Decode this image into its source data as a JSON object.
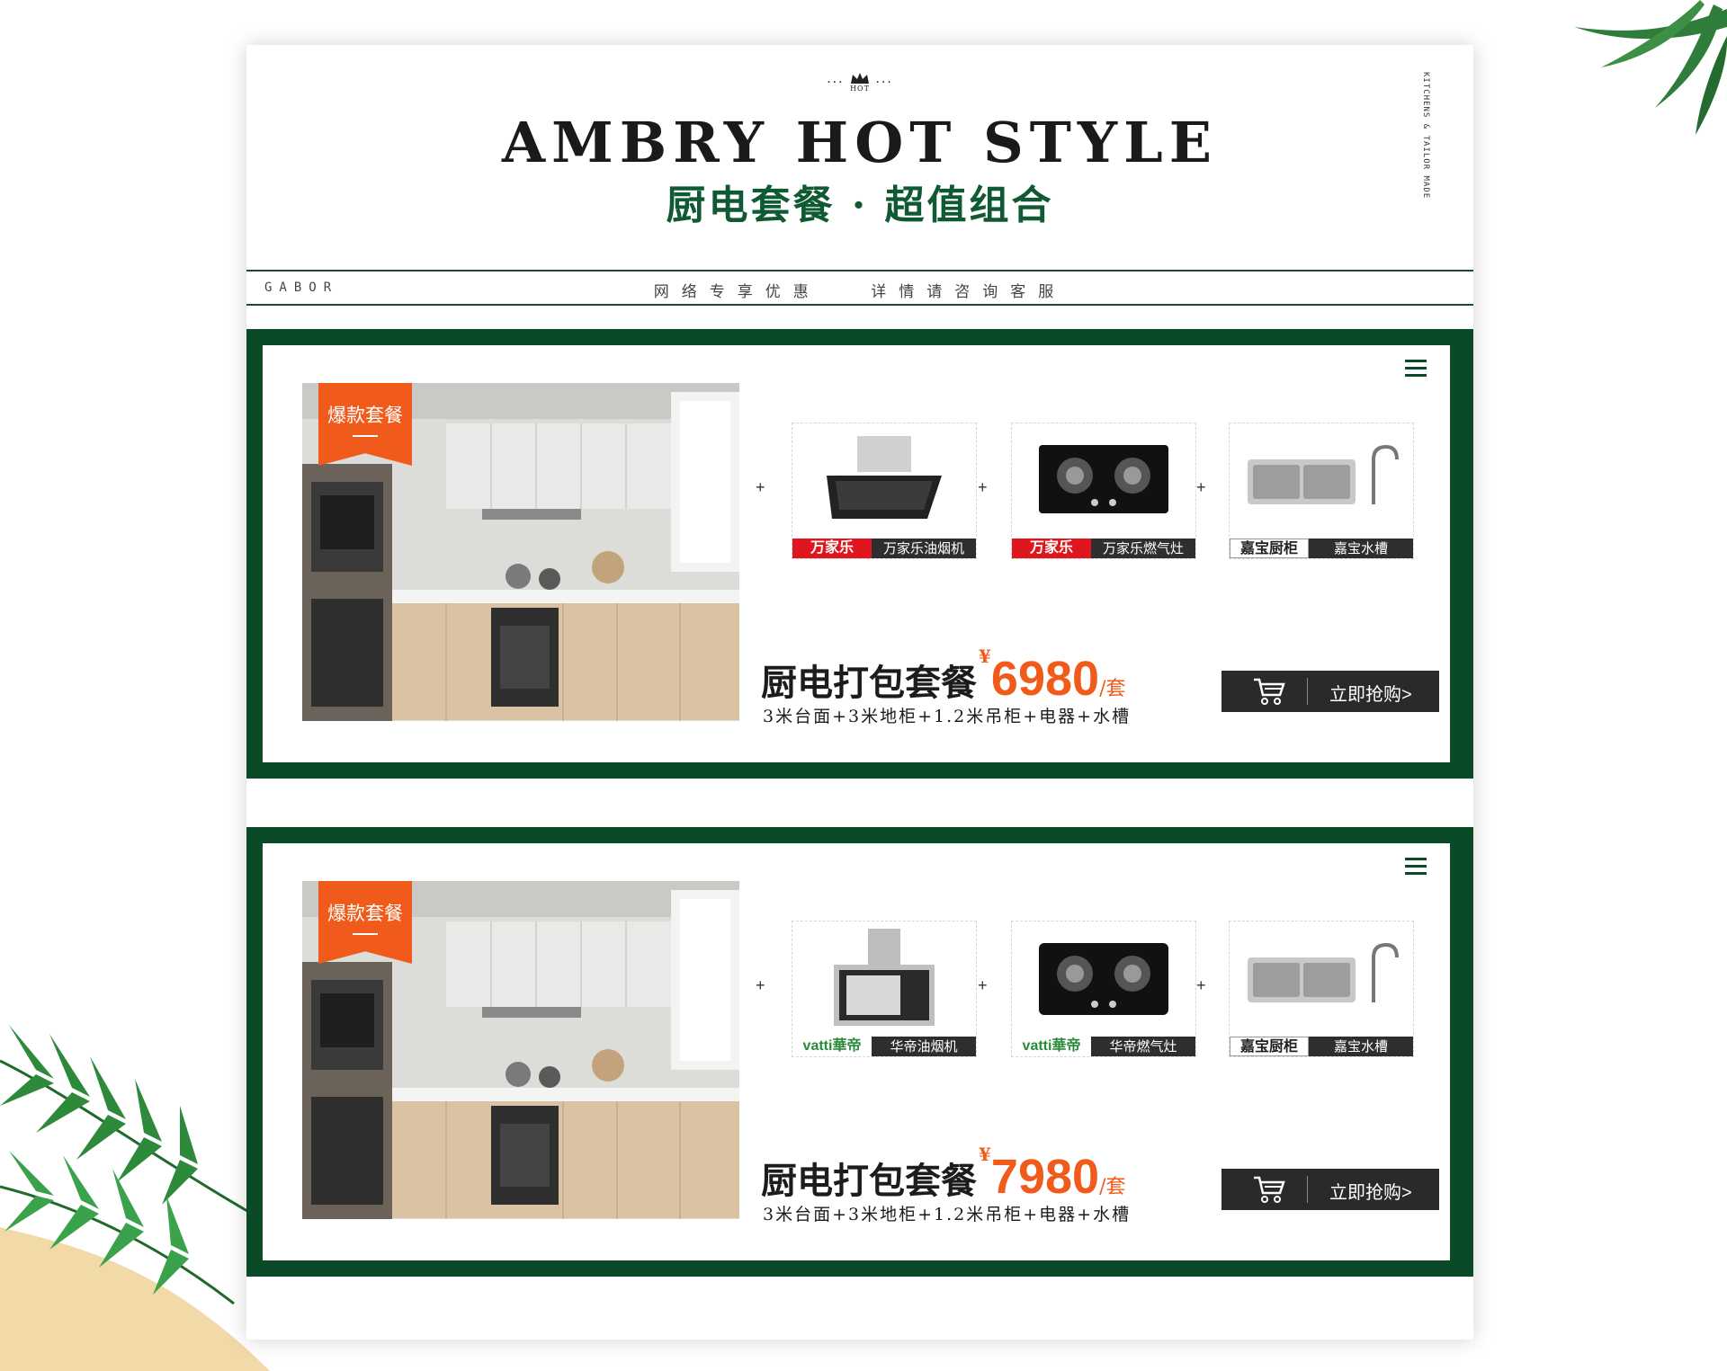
{
  "header": {
    "crown_dots": "...",
    "hot_badge": "HOT",
    "title_en": "AMBRY HOT STYLE",
    "title_cn": "厨电套餐 · 超值组合",
    "side_text": "KITCHENS & TAILOR MADE"
  },
  "band": {
    "brand": "GABOR",
    "promo_left": "网络专享优惠",
    "promo_right": "详情请咨询客服"
  },
  "packages": [
    {
      "badge": "爆款套餐",
      "products": [
        {
          "brand_logo": "万家乐",
          "name": "万家乐油烟机",
          "icon": "range-hood-icon"
        },
        {
          "brand_logo": "万家乐",
          "name": "万家乐燃气灶",
          "icon": "gas-stove-icon"
        },
        {
          "brand_logo": "嘉宝厨柜",
          "name": "嘉宝水槽",
          "icon": "sink-icon"
        }
      ],
      "plus": "+",
      "deal_title": "厨电打包套餐",
      "currency": "¥",
      "price": "6980",
      "unit": "/套",
      "details": "3米台面+3米地柜+1.2米吊柜+电器+水槽",
      "buy_label": "立即抢购>"
    },
    {
      "badge": "爆款套餐",
      "products": [
        {
          "brand_logo": "vatti華帝",
          "name": "华帝油烟机",
          "icon": "range-hood-icon"
        },
        {
          "brand_logo": "vatti華帝",
          "name": "华帝燃气灶",
          "icon": "gas-stove-icon"
        },
        {
          "brand_logo": "嘉宝厨柜",
          "name": "嘉宝水槽",
          "icon": "sink-icon"
        }
      ],
      "plus": "+",
      "deal_title": "厨电打包套餐",
      "currency": "¥",
      "price": "7980",
      "unit": "/套",
      "details": "3米台面+3米地柜+1.2米吊柜+电器+水槽",
      "buy_label": "立即抢购>"
    }
  ],
  "colors": {
    "brand_green": "#0b4a27",
    "accent_orange": "#f05a1a",
    "button_dark": "#2a2a2a"
  }
}
